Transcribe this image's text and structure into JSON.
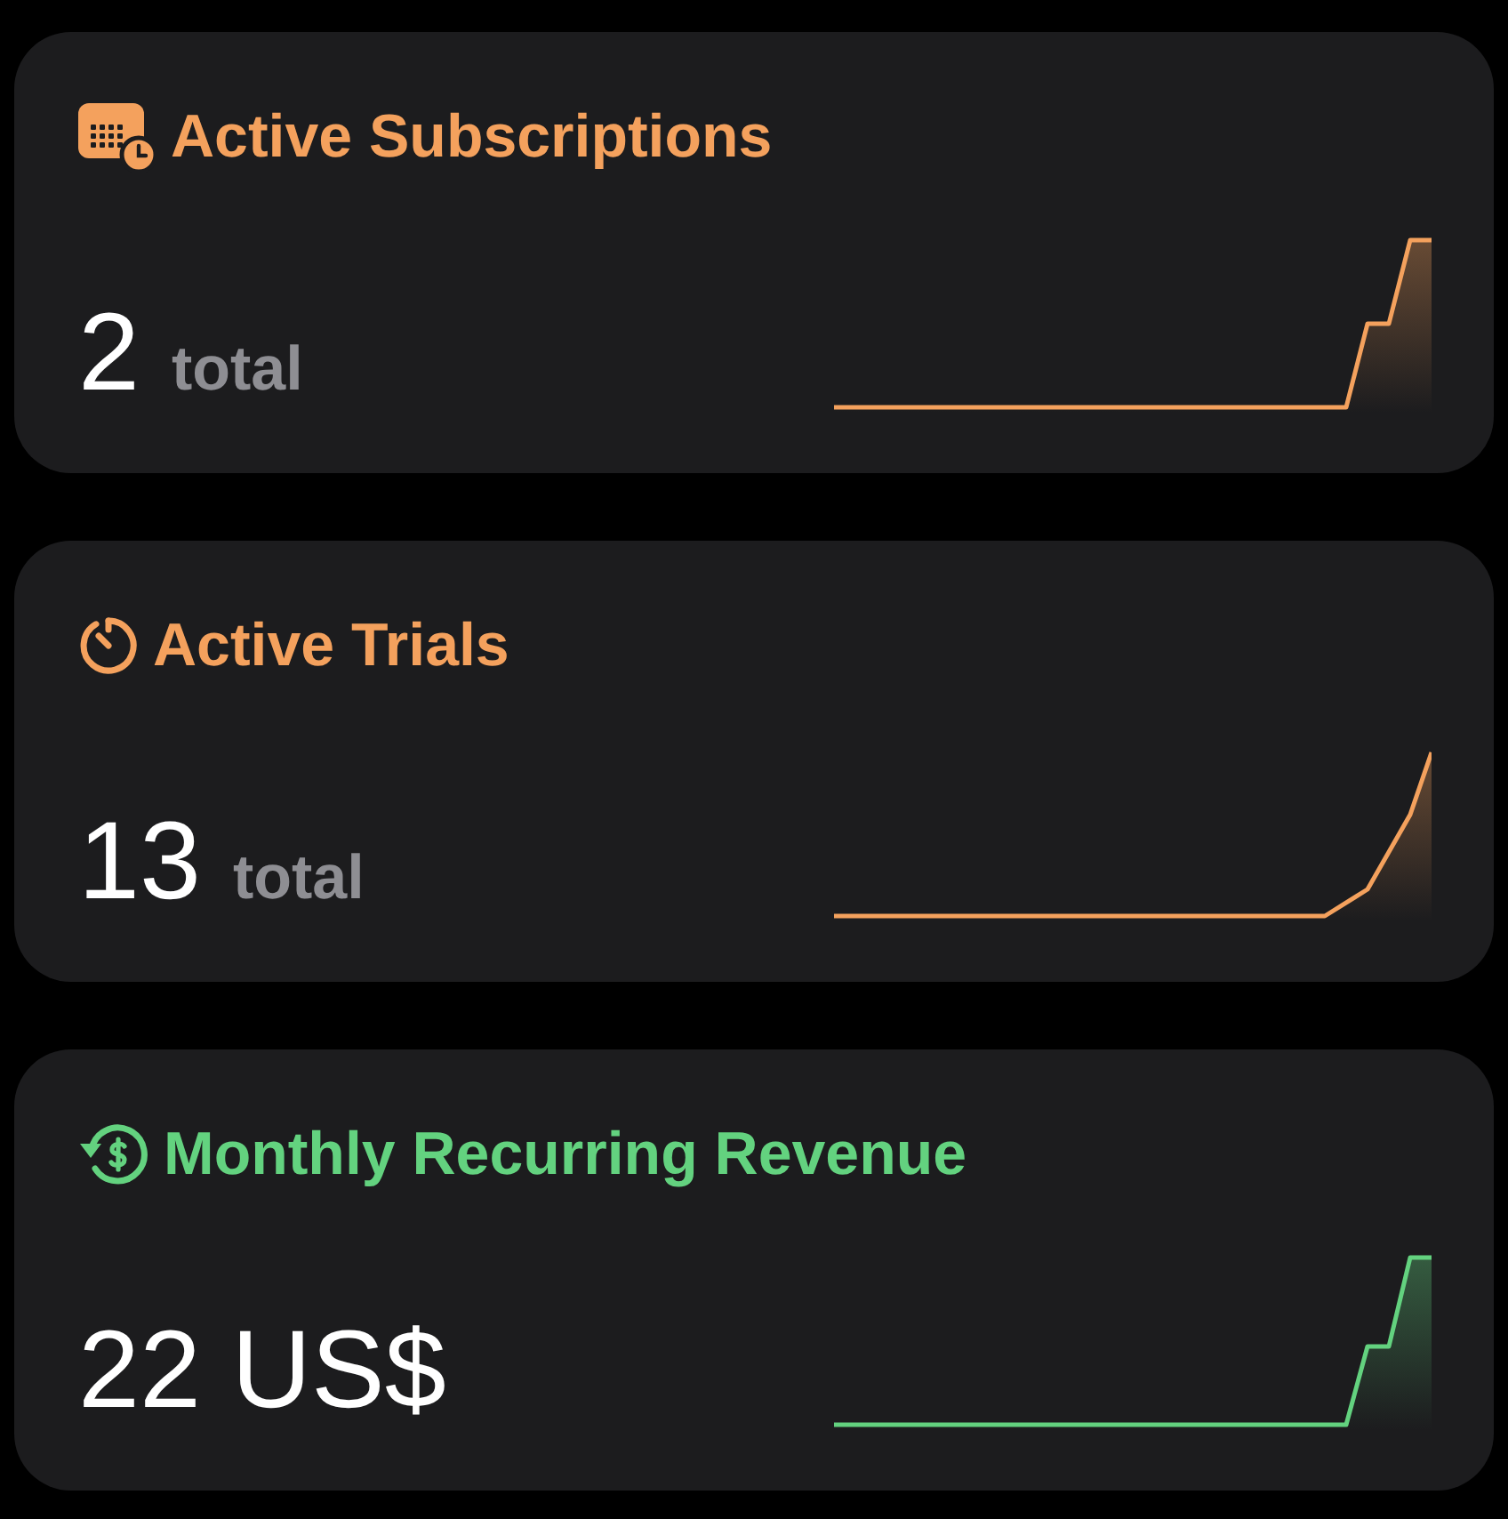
{
  "cards": [
    {
      "kind": "subscriptions",
      "title": "Active Subscriptions",
      "color": "#f4a15d",
      "value": "2",
      "unit": "total"
    },
    {
      "kind": "trials",
      "title": "Active Trials",
      "color": "#f4a15d",
      "value": "13",
      "unit": "total"
    },
    {
      "kind": "revenue",
      "title": "Monthly Recurring Revenue",
      "color": "#63d27f",
      "value": "22 US$"
    }
  ]
}
